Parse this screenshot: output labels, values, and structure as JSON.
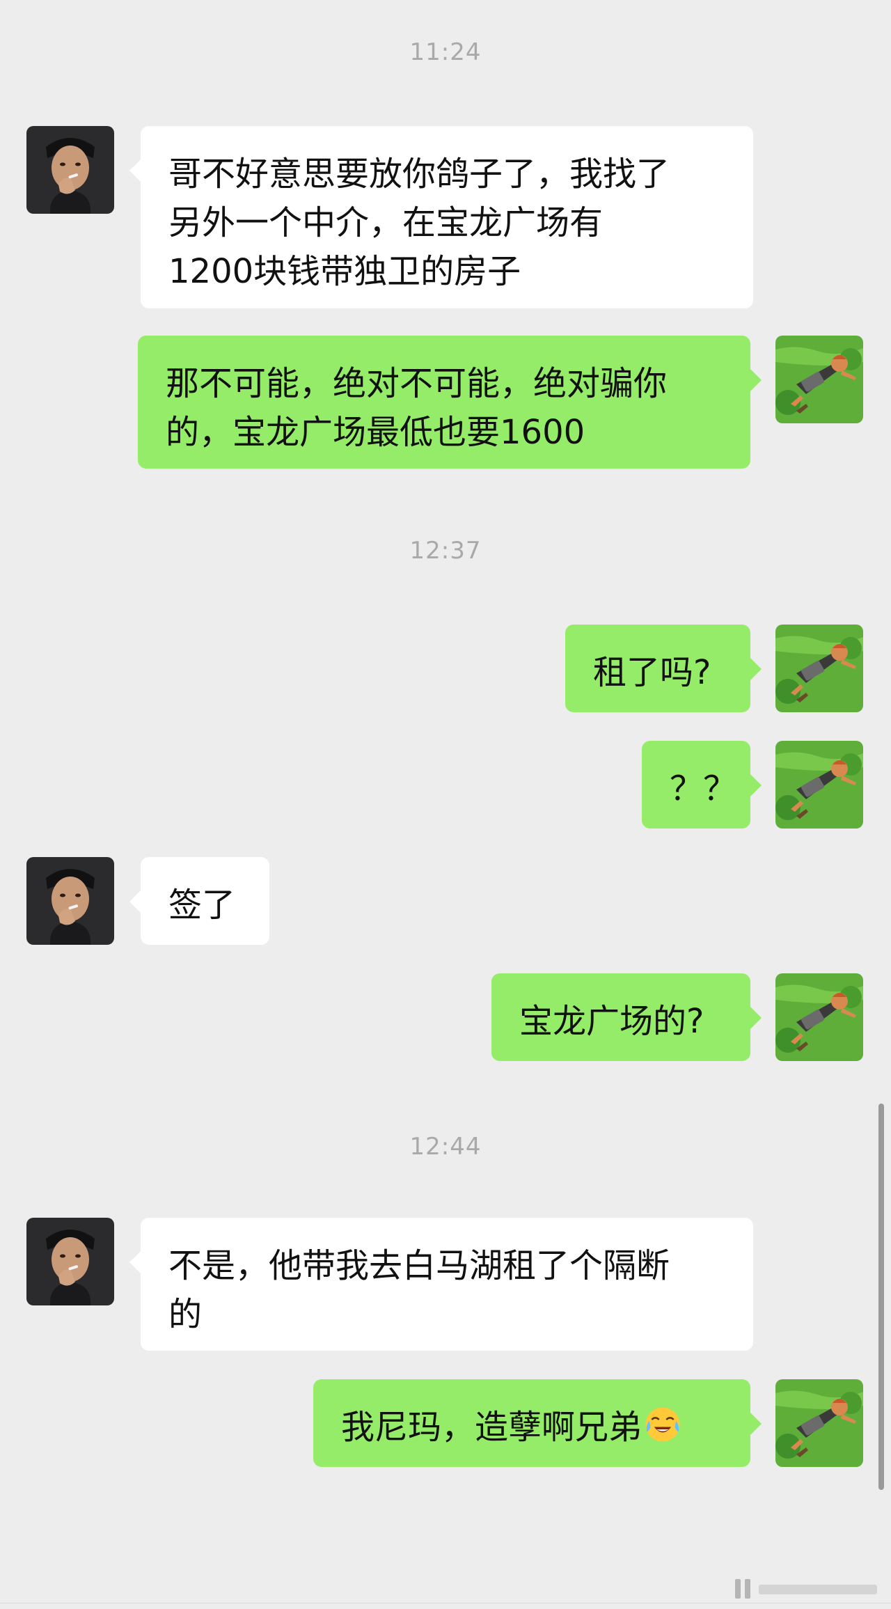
{
  "timestamps": [
    "11:24",
    "12:37",
    "12:44"
  ],
  "messages": [
    {
      "sender": "contact",
      "lines": [
        "哥不好意思要放你鸽子了，我找了",
        "另外一个中介，在宝龙广场有",
        "1200块钱带独卫的房子"
      ]
    },
    {
      "sender": "me",
      "lines": [
        "那不可能，绝对不可能，绝对骗你",
        "的，宝龙广场最低也要1600"
      ]
    },
    {
      "sender": "me",
      "lines": [
        "租了吗?"
      ]
    },
    {
      "sender": "me",
      "lines": [
        "？？"
      ]
    },
    {
      "sender": "contact",
      "lines": [
        "签了"
      ]
    },
    {
      "sender": "me",
      "lines": [
        "宝龙广场的?"
      ]
    },
    {
      "sender": "contact",
      "lines": [
        "不是，他带我去白马湖租了个隔断",
        "的"
      ]
    },
    {
      "sender": "me",
      "lines": [
        "我尼玛，造孽啊兄弟"
      ],
      "emoji": "crying-laughing-emoji"
    }
  ],
  "colors": {
    "background": "#ededed",
    "incoming_bubble": "#ffffff",
    "outgoing_bubble": "#95ec69",
    "timestamp_text": "#a9a9a9"
  },
  "avatars": {
    "contact": "contact-avatar-man-smoking",
    "me": "user-avatar-cartoon-boy-on-grass"
  }
}
